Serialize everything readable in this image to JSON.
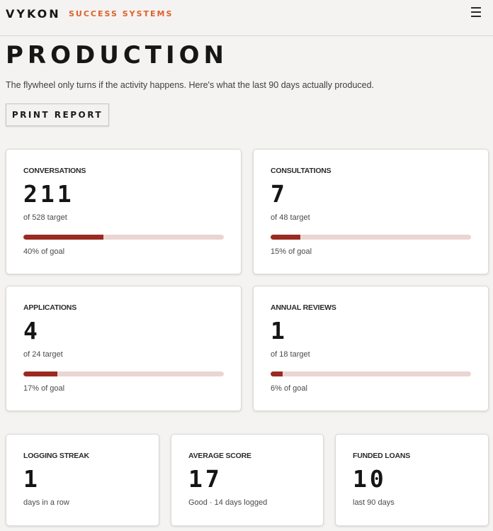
{
  "header": {
    "brand": "VYKON",
    "tagline": "SUCCESS SYSTEMS"
  },
  "page": {
    "title": "PRODUCTION",
    "subtitle": "The flywheel only turns if the activity happens. Here's what the last 90 days actually produced.",
    "print_label": "PRINT REPORT"
  },
  "metrics": [
    {
      "label": "CONVERSATIONS",
      "value": "211",
      "target": "of 528 target",
      "progress": 0.4,
      "pct_text": "40% of goal"
    },
    {
      "label": "CONSULTATIONS",
      "value": "7",
      "target": "of 48 target",
      "progress": 0.15,
      "pct_text": "15% of goal"
    },
    {
      "label": "APPLICATIONS",
      "value": "4",
      "target": "of 24 target",
      "progress": 0.17,
      "pct_text": "17% of goal"
    },
    {
      "label": "ANNUAL REVIEWS",
      "value": "1",
      "target": "of 18 target",
      "progress": 0.06,
      "pct_text": "6% of goal"
    }
  ],
  "stats": [
    {
      "label": "LOGGING STREAK",
      "value": "1",
      "sub": "days in a row"
    },
    {
      "label": "AVERAGE SCORE",
      "value": "17",
      "sub": "Good · 14 days logged"
    },
    {
      "label": "FUNDED LOANS",
      "value": "10",
      "sub": "last 90 days"
    }
  ],
  "colors": {
    "accent": "#e0602a",
    "bar_fill": "#9b2a22",
    "bar_track": "#ead5d2",
    "background": "#f4f3f1"
  }
}
